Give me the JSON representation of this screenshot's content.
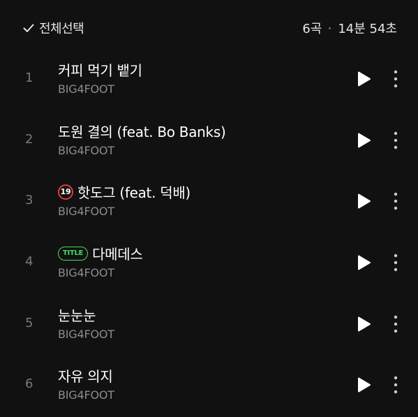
{
  "header": {
    "select_all_label": "전체선택",
    "track_count": "6곡",
    "duration": "14분 54초"
  },
  "badges": {
    "explicit": "19",
    "title": "TITLE"
  },
  "tracks": [
    {
      "number": "1",
      "title": "커피 먹기 뱉기",
      "artist": "BIG4FOOT"
    },
    {
      "number": "2",
      "title": "도원 결의 (feat. Bo Banks)",
      "artist": "BIG4FOOT"
    },
    {
      "number": "3",
      "title": "핫도그 (feat. 덕배)",
      "artist": "BIG4FOOT",
      "badge": "explicit"
    },
    {
      "number": "4",
      "title": "다메데스",
      "artist": "BIG4FOOT",
      "badge": "title"
    },
    {
      "number": "5",
      "title": "눈눈눈",
      "artist": "BIG4FOOT"
    },
    {
      "number": "6",
      "title": "자유 의지",
      "artist": "BIG4FOOT"
    }
  ],
  "icons": {
    "check": "check-icon",
    "play": "play-icon",
    "more": "more-vertical-icon"
  },
  "colors": {
    "background": "#111111",
    "explicit_badge": "#e23a3a",
    "title_badge": "#4cd964",
    "secondary_text": "#8c8c8c"
  }
}
